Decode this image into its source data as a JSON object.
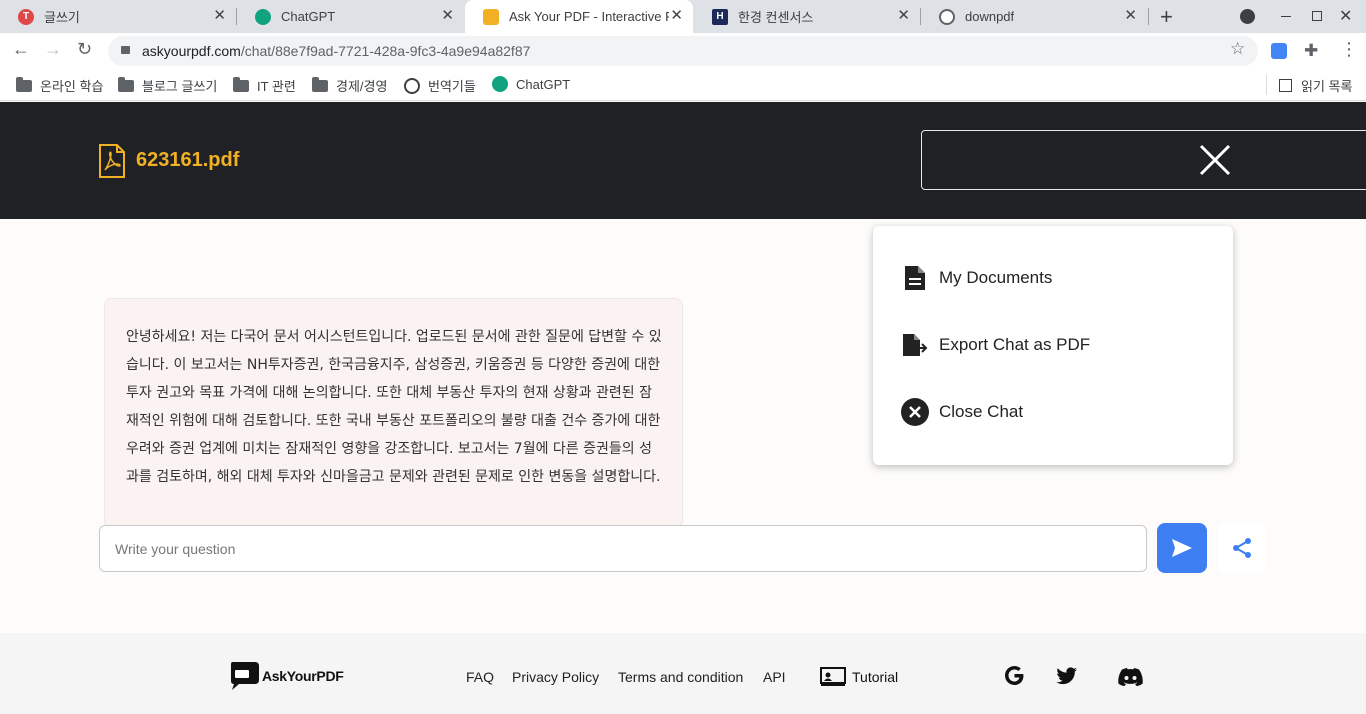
{
  "browser": {
    "tabs": [
      {
        "title": "글쓰기",
        "favicon_color": "#e04848",
        "favicon_glyph": "T",
        "active": false
      },
      {
        "title": "ChatGPT",
        "favicon_color": "#10a37f",
        "favicon_glyph": "",
        "active": false
      },
      {
        "title": "Ask Your PDF - Interactive PDF",
        "favicon_color": "#f2b124",
        "favicon_glyph": "",
        "active": true
      },
      {
        "title": "한경 컨센서스",
        "favicon_color": "#1c2a5a",
        "favicon_glyph": "H",
        "active": false
      },
      {
        "title": "downpdf",
        "favicon_color": "#5f6368",
        "favicon_glyph": "",
        "active": false
      }
    ],
    "new_tab_label": "+",
    "url_domain": "askyourpdf.com",
    "url_path": "/chat/88e7f9ad-7721-428a-9fc3-4a9e94a82f87",
    "bookmarks": [
      {
        "label": "온라인 학습",
        "icon": "folder-icon"
      },
      {
        "label": "블로그 글쓰기",
        "icon": "folder-icon"
      },
      {
        "label": "IT 관련",
        "icon": "folder-icon"
      },
      {
        "label": "경제/경영",
        "icon": "folder-icon"
      },
      {
        "label": "번역기들",
        "icon": "globe-icon"
      },
      {
        "label": "ChatGPT",
        "icon": "chatgpt-icon"
      }
    ],
    "reading_list": "읽기 목록"
  },
  "header": {
    "filename": "623161.pdf",
    "accent_color": "#f2b124"
  },
  "chat": {
    "messages": [
      {
        "role": "assistant",
        "text": "안녕하세요! 저는 다국어 문서 어시스턴트입니다. 업로드된 문서에 관한 질문에 답변할 수 있습니다. 이 보고서는 NH투자증권, 한국금융지주, 삼성증권, 키움증권 등 다양한 증권에 대한 투자 권고와 목표 가격에 대해 논의합니다. 또한 대체 부동산 투자의 현재 상황과 관련된 잠재적인 위험에 대해 검토합니다. 또한 국내 부동산 포트폴리오의 불량 대출 건수 증가에 대한 우려와 증권 업계에 미치는 잠재적인 영향을 강조합니다. 보고서는 7월에 다른 증권들의 성과를 검토하며, 해외 대체 투자와 신마을금고 문제와 관련된 문제로 인한 변동을 설명합니다."
      }
    ],
    "input_placeholder": "Write your question"
  },
  "menu": {
    "items": [
      {
        "label": "My Documents",
        "icon": "document-icon"
      },
      {
        "label": "Export Chat as PDF",
        "icon": "export-icon"
      },
      {
        "label": "Close Chat",
        "icon": "close-circle-icon"
      }
    ]
  },
  "footer": {
    "brand": "AskYourPDF",
    "links": [
      "FAQ",
      "Privacy Policy",
      "Terms and condition",
      "API"
    ],
    "tutorial": "Tutorial",
    "social": [
      "google-icon",
      "twitter-icon",
      "discord-icon"
    ]
  }
}
